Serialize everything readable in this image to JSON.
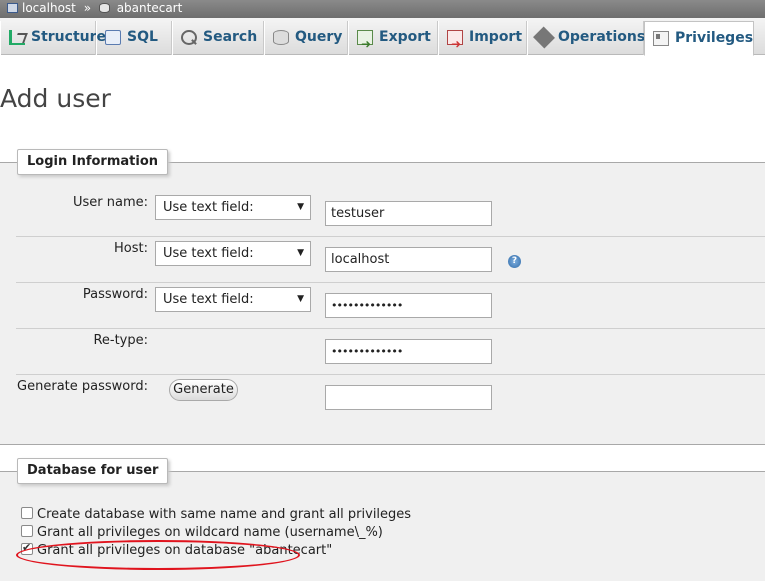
{
  "breadcrumb": {
    "server": "localhost",
    "separator": "»",
    "database": "abantecart"
  },
  "tabs": [
    {
      "label": "Structure",
      "icon": "structure-icon"
    },
    {
      "label": "SQL",
      "icon": "sql-icon"
    },
    {
      "label": "Search",
      "icon": "search-icon"
    },
    {
      "label": "Query",
      "icon": "query-icon"
    },
    {
      "label": "Export",
      "icon": "export-icon"
    },
    {
      "label": "Import",
      "icon": "import-icon"
    },
    {
      "label": "Operations",
      "icon": "operations-icon"
    },
    {
      "label": "Privileges",
      "icon": "privileges-icon",
      "active": true
    }
  ],
  "page": {
    "title": "Add user"
  },
  "login": {
    "legend": "Login Information",
    "username": {
      "label": "User name:",
      "select": "Use text field:",
      "value": "testuser"
    },
    "host": {
      "label": "Host:",
      "select": "Use text field:",
      "value": "localhost"
    },
    "password": {
      "label": "Password:",
      "select": "Use text field:",
      "value": "•••••••••••••"
    },
    "retype": {
      "label": "Re-type:",
      "value": "•••••••••••••"
    },
    "generate": {
      "label": "Generate password:",
      "button": "Generate",
      "value": ""
    }
  },
  "database": {
    "legend": "Database for user",
    "options": [
      {
        "label": "Create database with same name and grant all privileges",
        "checked": false
      },
      {
        "label": "Grant all privileges on wildcard name (username\\_%)",
        "checked": false
      },
      {
        "label": "Grant all privileges on database \"abantecart\"",
        "checked": true
      }
    ]
  },
  "colors": {
    "tab_text": "#235a81",
    "annotation": "#e0141e",
    "fieldset_bg": "#f0f0f0"
  }
}
